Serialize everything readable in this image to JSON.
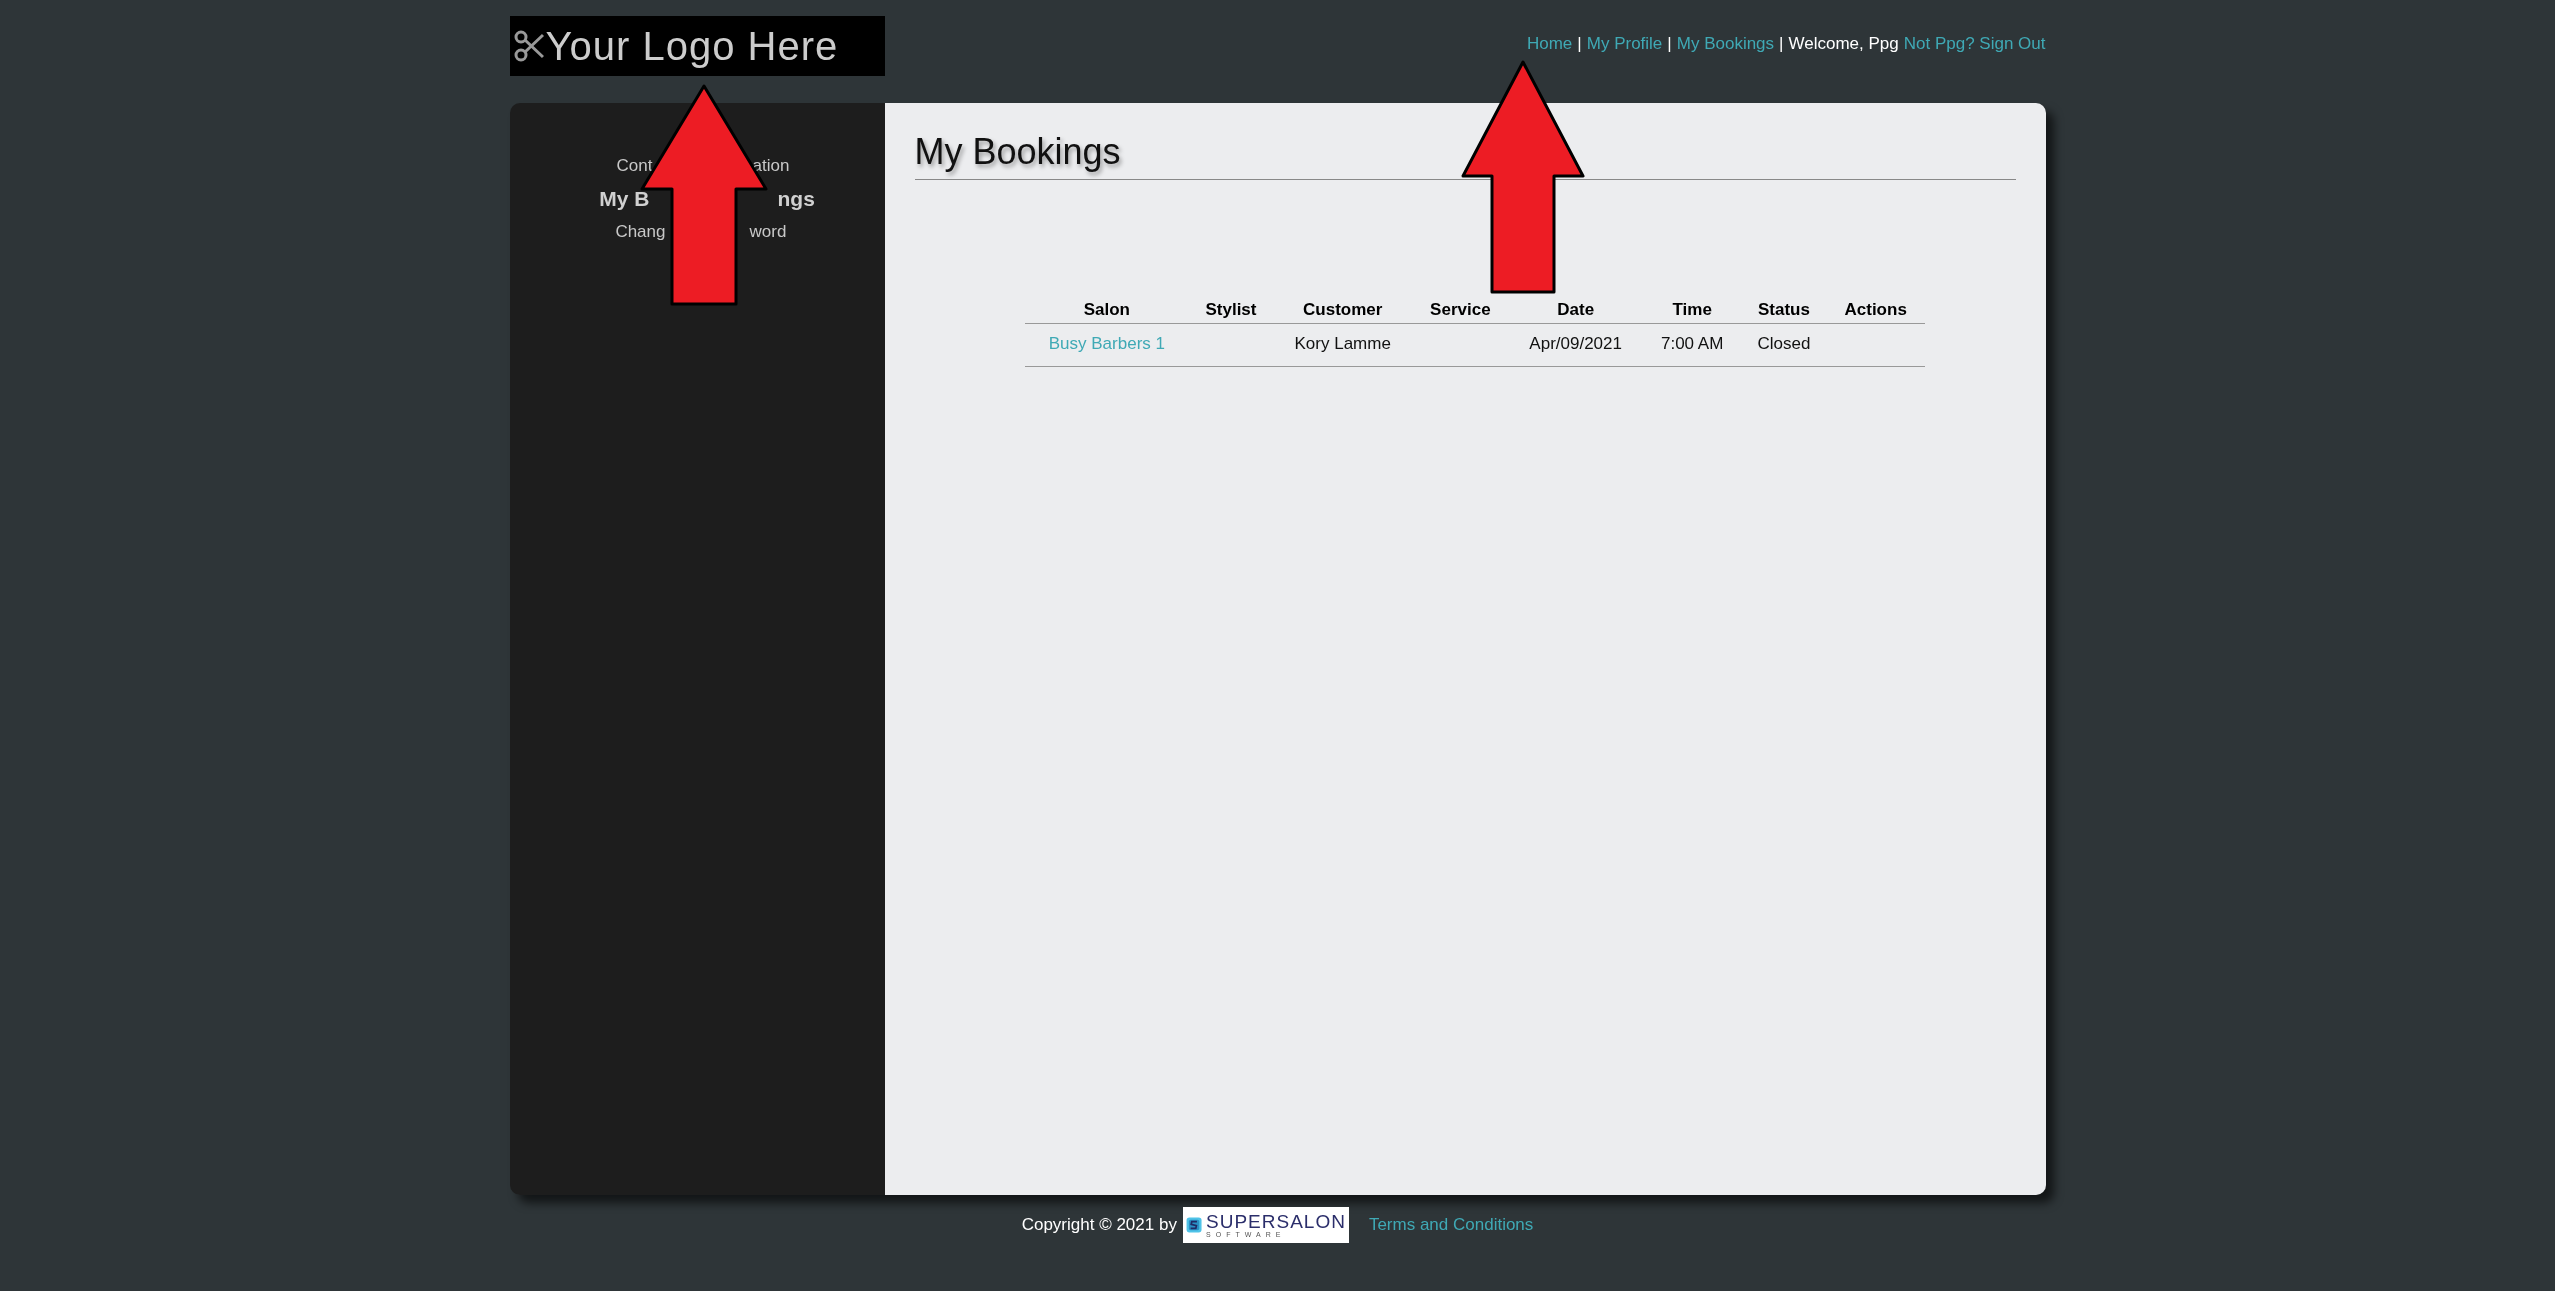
{
  "logo": {
    "text": "Your Logo Here"
  },
  "nav": [
    {
      "kind": "link",
      "text": "Home"
    },
    {
      "kind": "sep",
      "text": "|"
    },
    {
      "kind": "link",
      "text": "My Profile"
    },
    {
      "kind": "sep",
      "text": "|"
    },
    {
      "kind": "link",
      "text": "My Bookings"
    },
    {
      "kind": "sep",
      "text": "|"
    },
    {
      "kind": "plain",
      "text": "Welcome, Ppg"
    },
    {
      "kind": "link",
      "text": "Not Ppg? Sign Out"
    }
  ],
  "sidebar": {
    "items": [
      {
        "visible_parts": [
          "Cont",
          "ation"
        ],
        "selected": false
      },
      {
        "visible_parts": [
          "My B",
          "ngs"
        ],
        "selected": true
      },
      {
        "visible_parts": [
          "Chang",
          "word"
        ],
        "selected": false
      }
    ]
  },
  "title": "My Bookings",
  "table": {
    "columns": [
      "Salon",
      "Stylist",
      "Customer",
      "Service",
      "Date",
      "Time",
      "Status",
      "Actions"
    ],
    "rows": [
      [
        {
          "kind": "link",
          "text": "Busy Barbers 1"
        },
        {
          "kind": "empty"
        },
        {
          "kind": "text",
          "text": "Kory Lamme"
        },
        {
          "kind": "empty"
        },
        {
          "kind": "text",
          "text": "Apr/09/2021"
        },
        {
          "kind": "text",
          "text": "7:00 AM"
        },
        {
          "kind": "text",
          "text": "Closed"
        },
        {
          "kind": "empty"
        }
      ]
    ]
  },
  "callouts": [
    {
      "kind": "arrow"
    },
    {
      "kind": "arrow"
    }
  ],
  "footer": {
    "copyright": "Copyright © 2021 by",
    "brand": "SUPERSALON",
    "brand_sub": "SOFTWARE",
    "terms": "Terms and Conditions"
  }
}
